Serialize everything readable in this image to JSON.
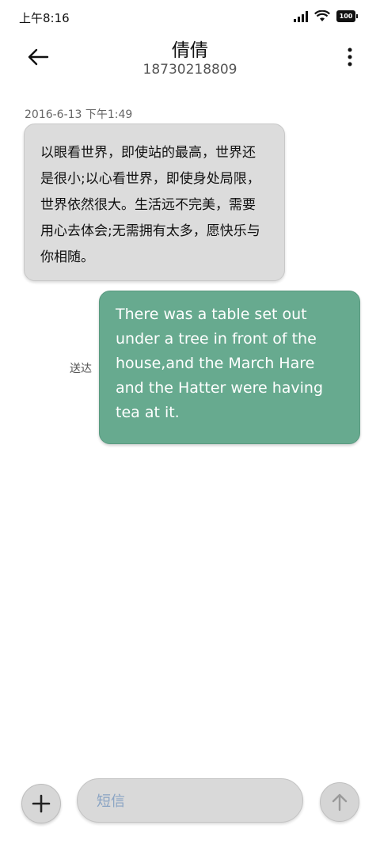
{
  "status_bar": {
    "time": "上午8:16",
    "battery": "100",
    "icons": [
      "signal-icon",
      "wifi-icon",
      "battery-icon"
    ]
  },
  "header": {
    "contact_name": "倩倩",
    "phone_number": "18730218809",
    "icons": [
      "back-arrow-icon",
      "more-vertical-icon"
    ]
  },
  "conversation": {
    "timestamp": "2016-6-13 下午1:49",
    "received_message": "以眼看世界，即使站的最高，世界还是很小;以心看世界，即使身处局限，世界依然很大。生活远不完美，需要用心去体会;无需拥有太多，愿快乐与你相随。",
    "sent_message": "There was a table set out under a tree in front of the house,and the March Hare and the Hatter were having tea at it.",
    "sent_status": "送达"
  },
  "composer": {
    "placeholder": "短信",
    "icons": [
      "plus-icon",
      "send-arrow-icon"
    ]
  },
  "colors": {
    "sent_bubble": "#67aa8f",
    "received_bubble": "#dcdcdc",
    "placeholder": "#8aa4c4"
  }
}
